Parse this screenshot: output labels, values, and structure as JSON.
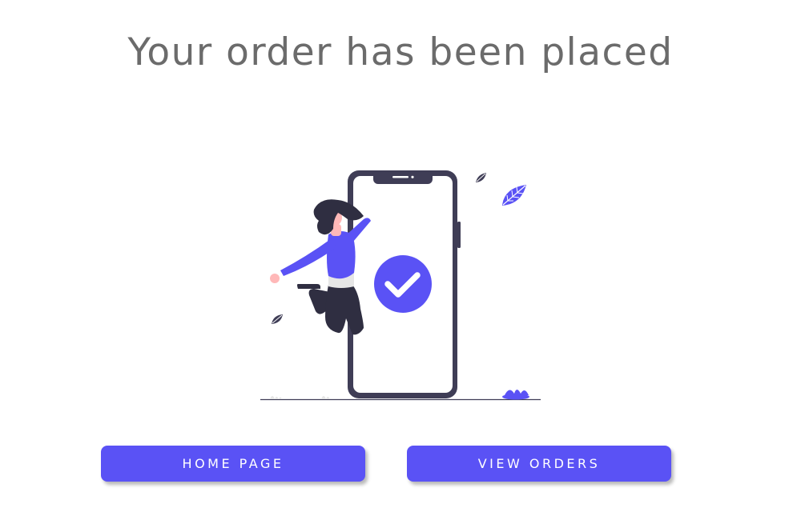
{
  "page": {
    "title": "Your order has been placed"
  },
  "illustration": {
    "name": "order-success-illustration",
    "icon": "checkmark-icon"
  },
  "actions": {
    "home_label": "HOME PAGE",
    "orders_label": "VIEW ORDERS"
  },
  "colors": {
    "accent": "#5a52f5",
    "dark": "#3f3d56",
    "title_text": "#6b6b6b",
    "skin": "#ffb8b8"
  }
}
